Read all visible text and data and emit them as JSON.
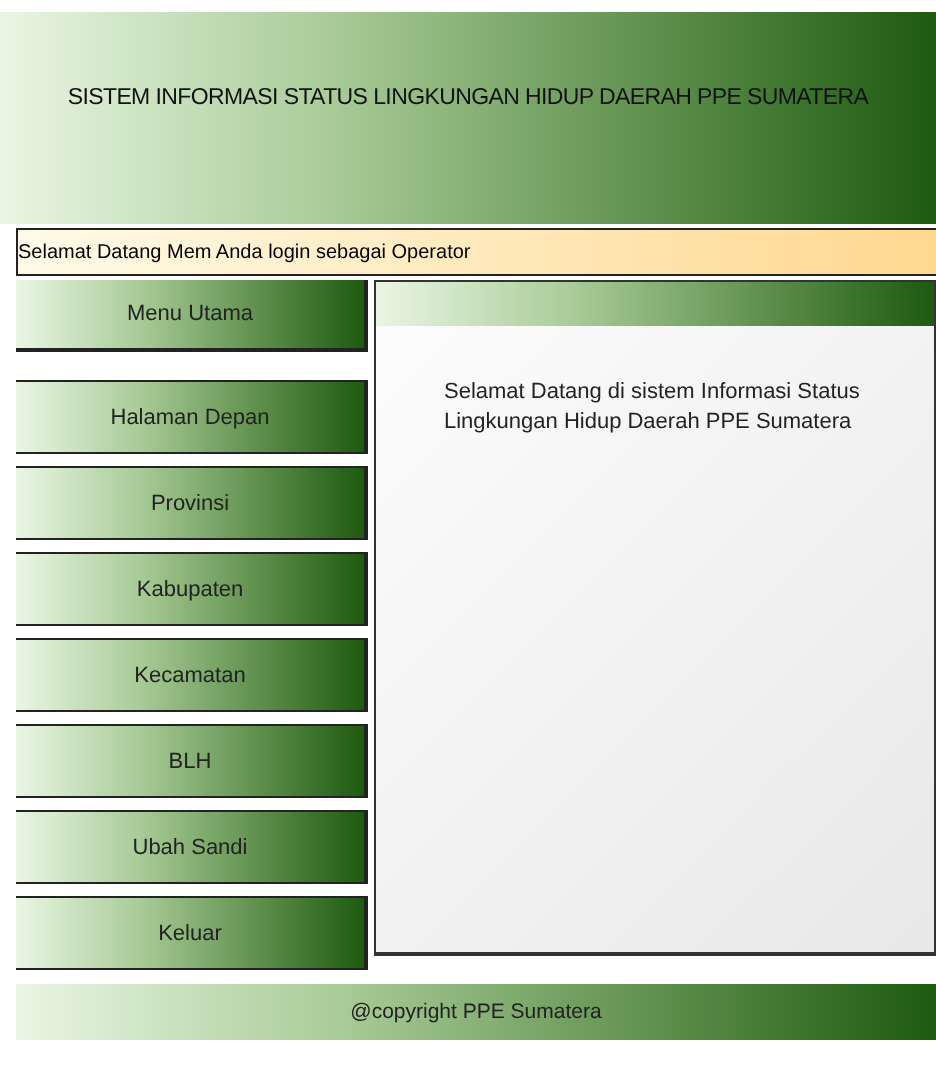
{
  "header": {
    "title": "SISTEM INFORMASI STATUS LINGKUNGAN HIDUP DAERAH PPE SUMATERA"
  },
  "welcome_bar": {
    "text": "Selamat Datang Mem Anda login sebagai Operator"
  },
  "sidebar": {
    "heading": "Menu Utama",
    "items": [
      {
        "label": "Halaman Depan"
      },
      {
        "label": "Provinsi"
      },
      {
        "label": "Kabupaten"
      },
      {
        "label": "Kecamatan"
      },
      {
        "label": "BLH"
      },
      {
        "label": "Ubah Sandi"
      },
      {
        "label": "Keluar"
      }
    ]
  },
  "content": {
    "text": "Selamat Datang di sistem Informasi Status Lingkungan Hidup Daerah PPE Sumatera"
  },
  "footer": {
    "text": "@copyright PPE Sumatera"
  }
}
